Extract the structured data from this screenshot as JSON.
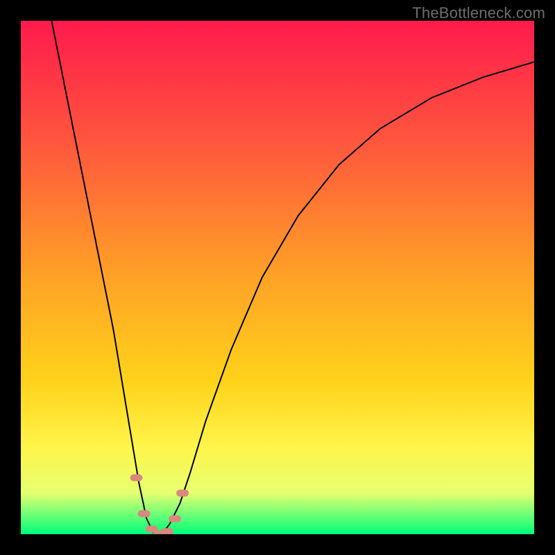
{
  "watermark": "TheBottleneck.com",
  "gradient_colors": {
    "top": "#ff1a4d",
    "upper": "#ff5a3c",
    "mid": "#ffa226",
    "lower": "#ffd21a",
    "band_top": "#fff44a",
    "band_mid": "#e5ff70",
    "bottom": "#00ff7a"
  },
  "chart_data": {
    "type": "line",
    "title": "",
    "xlabel": "",
    "ylabel": "",
    "xlim": [
      0,
      100
    ],
    "ylim": [
      0,
      100
    ],
    "annotations": [
      "TheBottleneck.com"
    ],
    "series": [
      {
        "name": "bottleneck-curve",
        "x": [
          6,
          10,
          14,
          18,
          21,
          23,
          24.5,
          26,
          27.5,
          29,
          31,
          33,
          36,
          41,
          47,
          54,
          62,
          70,
          80,
          90,
          100
        ],
        "values": [
          100,
          80,
          60,
          40,
          22,
          10,
          3,
          0,
          0,
          2,
          6,
          12,
          22,
          36,
          50,
          62,
          72,
          79,
          85,
          89,
          92
        ]
      }
    ],
    "markers": {
      "name": "highlight-points",
      "x": [
        22.5,
        24,
        25.5,
        27,
        28.5,
        30,
        31.5
      ],
      "values": [
        11,
        4,
        1,
        0,
        0.5,
        3,
        8
      ]
    }
  }
}
